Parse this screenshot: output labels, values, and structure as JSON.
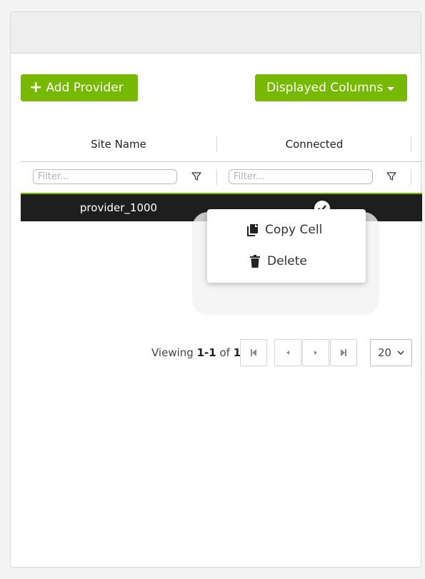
{
  "toolbar": {
    "add_label": "Add Provider",
    "columns_label": "Displayed Columns"
  },
  "table": {
    "columns": [
      "Site Name",
      "Connected"
    ],
    "filter_placeholder": "Filter...",
    "rows": [
      {
        "site_name": "provider_1000",
        "connected": true
      }
    ]
  },
  "context_menu": {
    "items": [
      "Copy Cell",
      "Delete"
    ]
  },
  "pagination": {
    "viewing_prefix": "Viewing",
    "range": "1-1",
    "of_label": "of",
    "total": "1",
    "page_size": "20"
  },
  "colors": {
    "accent": "#76b900",
    "row_selected": "#1e1e1e"
  },
  "icons": [
    "plus-icon",
    "caret-down-icon",
    "filter-icon",
    "check-circle-icon",
    "copy-icon",
    "trash-icon",
    "first-page-icon",
    "prev-page-icon",
    "next-page-icon",
    "last-page-icon",
    "chevron-down-icon"
  ]
}
